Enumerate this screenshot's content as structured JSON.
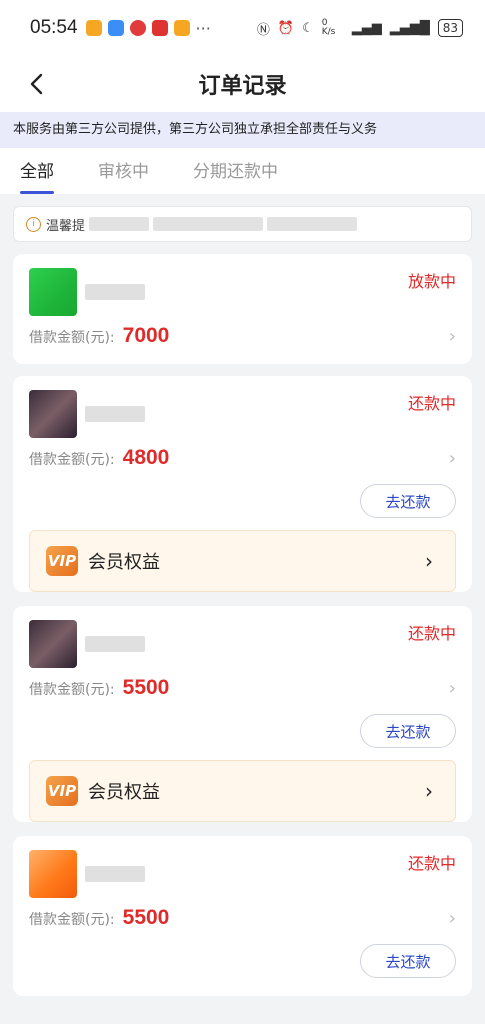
{
  "status_bar": {
    "time": "05:54",
    "net_speed": "0 K/s",
    "battery": "83"
  },
  "nav": {
    "title": "订单记录"
  },
  "notice": "本服务由第三方公司提供，第三方公司独立承担全部责任与义务",
  "tabs": [
    {
      "label": "全部",
      "active": true
    },
    {
      "label": "审核中"
    },
    {
      "label": "分期还款中"
    }
  ],
  "tip": {
    "prefix": "温馨提"
  },
  "orders": [
    {
      "status": "放款中",
      "amount_label": "借款金额(元):",
      "amount": "7000"
    },
    {
      "status": "还款中",
      "amount_label": "借款金额(元):",
      "amount": "4800",
      "action": "去还款",
      "vip": "会员权益",
      "vip_badge": "VIP"
    },
    {
      "status": "还款中",
      "amount_label": "借款金额(元):",
      "amount": "5500",
      "action": "去还款",
      "vip": "会员权益",
      "vip_badge": "VIP"
    },
    {
      "status": "还款中",
      "amount_label": "借款金额(元):",
      "amount": "5500",
      "action": "去还款"
    }
  ],
  "colors": {
    "accent": "#3a56d6",
    "status_red": "#e02b2b",
    "notice_bg": "#e9ebfb"
  }
}
